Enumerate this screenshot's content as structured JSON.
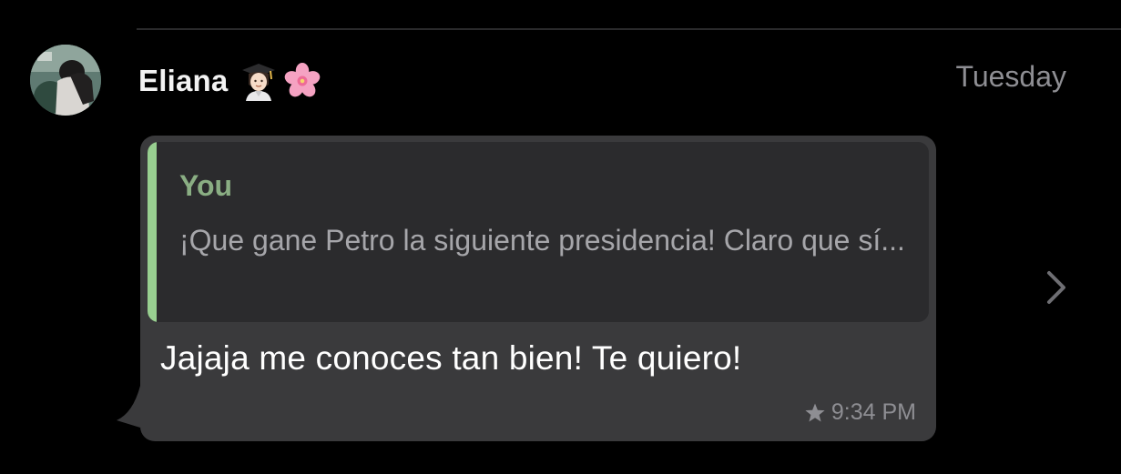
{
  "thread": {
    "sender_name": "Eliana",
    "sender_emojis": [
      "graduate-woman-emoji",
      "cherry-blossom-emoji"
    ],
    "day": "Tuesday"
  },
  "message": {
    "quote_author": "You",
    "quote_text": "¡Que gane Petro la siguiente presidencia! Claro que sí...",
    "text": "Jajaja me conoces tan bien! Te quiero!",
    "time": "9:34 PM",
    "starred": true
  },
  "icons": {
    "star": "star-icon",
    "chevron": "chevron-right-icon"
  },
  "colors": {
    "background": "#000000",
    "bubble": "#3a3a3c",
    "quote_background": "#2b2b2d",
    "quote_accent": "#98cf90",
    "quote_author": "#8aae83",
    "secondary_text": "#8e8e93"
  }
}
